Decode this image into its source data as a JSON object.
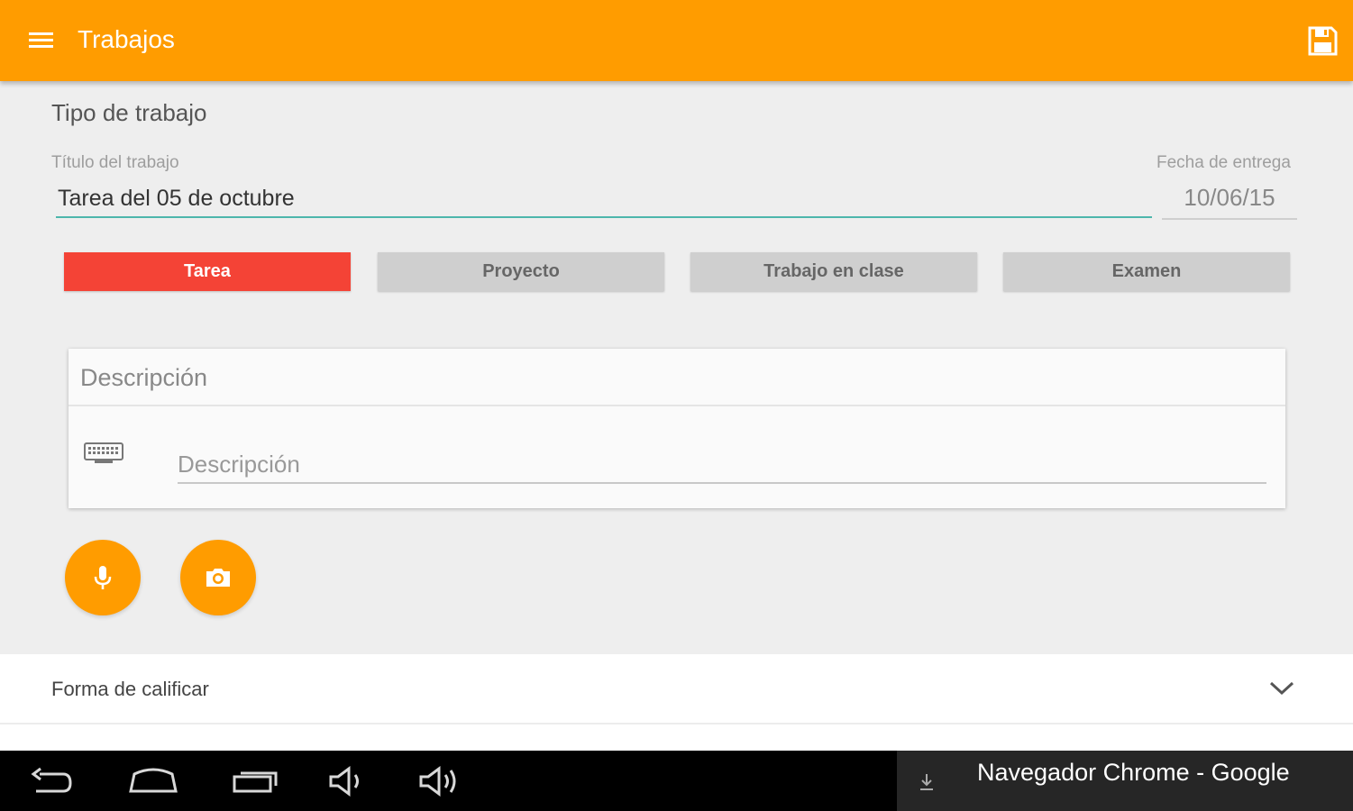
{
  "appbar": {
    "title": "Trabajos",
    "menu_icon": "menu-icon",
    "save_icon": "save-icon",
    "background_color": "#ff9c00"
  },
  "form": {
    "section_title": "Tipo de trabajo",
    "title_label": "Título del trabajo",
    "title_value": "Tarea del 05 de octubre",
    "date_label": "Fecha de entrega",
    "date_value": "10/06/15"
  },
  "type_buttons": [
    {
      "label": "Tarea",
      "selected": true,
      "color": "#f44336"
    },
    {
      "label": "Proyecto",
      "selected": false
    },
    {
      "label": "Trabajo en clase",
      "selected": false
    },
    {
      "label": "Examen",
      "selected": false
    }
  ],
  "description_card": {
    "header": "Descripción",
    "input_placeholder": "Descripción",
    "input_value": "",
    "icon": "keyboard-icon"
  },
  "actions": {
    "mic_icon": "microphone-icon",
    "camera_icon": "camera-icon",
    "accent_color": "#ff9c00"
  },
  "grading": {
    "label": "Forma de calificar",
    "icon": "chevron-down-icon"
  },
  "system_bar": {
    "buttons": [
      "back-icon",
      "home-icon",
      "recent-apps-icon",
      "volume-down-icon",
      "volume-up-icon"
    ],
    "notification_icon": "download-icon",
    "notification_text": "Navegador Chrome - Google"
  }
}
